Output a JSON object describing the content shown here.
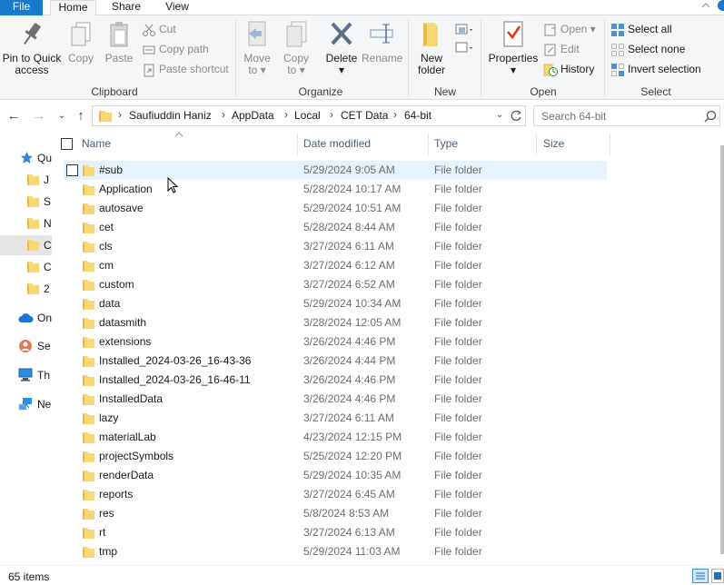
{
  "tabs": {
    "file": "File",
    "home": "Home",
    "share": "Share",
    "view": "View"
  },
  "ribbon": {
    "clipboard": {
      "pin_line1": "Pin to Quick",
      "pin_line2": "access",
      "copy": "Copy",
      "paste": "Paste",
      "cut": "Cut",
      "copy_path": "Copy path",
      "paste_shortcut": "Paste shortcut",
      "label": "Clipboard"
    },
    "organize": {
      "move_line1": "Move",
      "move_line2": "to",
      "copy_line1": "Copy",
      "copy_line2": "to",
      "delete": "Delete",
      "rename": "Rename",
      "label": "Organize"
    },
    "new": {
      "new_line1": "New",
      "new_line2": "folder",
      "label": "New"
    },
    "open": {
      "properties": "Properties",
      "open": "Open",
      "edit": "Edit",
      "history": "History",
      "label": "Open"
    },
    "select": {
      "select_all": "Select all",
      "select_none": "Select none",
      "invert": "Invert selection",
      "label": "Select"
    }
  },
  "address": {
    "crumbs": [
      "Saufiuddin Haniz",
      "AppData",
      "Local",
      "CET Data",
      "64-bit"
    ],
    "search_placeholder": "Search 64-bit"
  },
  "nav": {
    "items": [
      {
        "label": "Qu",
        "icon": "star-icon"
      },
      {
        "label": "J",
        "icon": "folder-icon"
      },
      {
        "label": "S",
        "icon": "folder-icon"
      },
      {
        "label": "N",
        "icon": "folder-icon"
      },
      {
        "label": "C",
        "icon": "folder-icon"
      },
      {
        "label": "C",
        "icon": "folder-icon"
      },
      {
        "label": "2",
        "icon": "folder-icon"
      },
      {
        "label": "On",
        "icon": "cloud-icon"
      },
      {
        "label": "Se",
        "icon": "user-icon"
      },
      {
        "label": "Th",
        "icon": "computer-icon"
      },
      {
        "label": "Ne",
        "icon": "network-icon"
      }
    ]
  },
  "columns": {
    "name": "Name",
    "date": "Date modified",
    "type": "Type",
    "size": "Size"
  },
  "files": [
    {
      "name": "#sub",
      "date": "5/29/2024 9:05 AM",
      "type": "File folder"
    },
    {
      "name": "Application",
      "date": "5/28/2024 10:17 AM",
      "type": "File folder"
    },
    {
      "name": "autosave",
      "date": "5/29/2024 10:51 AM",
      "type": "File folder"
    },
    {
      "name": "cet",
      "date": "5/28/2024 8:44 AM",
      "type": "File folder"
    },
    {
      "name": "cls",
      "date": "3/27/2024 6:11 AM",
      "type": "File folder"
    },
    {
      "name": "cm",
      "date": "3/27/2024 6:12 AM",
      "type": "File folder"
    },
    {
      "name": "custom",
      "date": "3/27/2024 6:52 AM",
      "type": "File folder"
    },
    {
      "name": "data",
      "date": "5/29/2024 10:34 AM",
      "type": "File folder"
    },
    {
      "name": "datasmith",
      "date": "3/28/2024 12:05 AM",
      "type": "File folder"
    },
    {
      "name": "extensions",
      "date": "3/26/2024 4:46 PM",
      "type": "File folder"
    },
    {
      "name": "Installed_2024-03-26_16-43-36",
      "date": "3/26/2024 4:44 PM",
      "type": "File folder"
    },
    {
      "name": "Installed_2024-03-26_16-46-11",
      "date": "3/26/2024 4:46 PM",
      "type": "File folder"
    },
    {
      "name": "InstalledData",
      "date": "3/26/2024 4:46 PM",
      "type": "File folder"
    },
    {
      "name": "lazy",
      "date": "3/27/2024 6:11 AM",
      "type": "File folder"
    },
    {
      "name": "materialLab",
      "date": "4/23/2024 12:15 PM",
      "type": "File folder"
    },
    {
      "name": "projectSymbols",
      "date": "5/25/2024 12:20 PM",
      "type": "File folder"
    },
    {
      "name": "renderData",
      "date": "5/29/2024 10:35 AM",
      "type": "File folder"
    },
    {
      "name": "reports",
      "date": "3/27/2024 6:45 AM",
      "type": "File folder"
    },
    {
      "name": "res",
      "date": "5/8/2024 8:53 AM",
      "type": "File folder"
    },
    {
      "name": "rt",
      "date": "3/27/2024 6:13 AM",
      "type": "File folder"
    },
    {
      "name": "tmp",
      "date": "5/29/2024 11:03 AM",
      "type": "File folder"
    }
  ],
  "status": {
    "count": "65 items"
  },
  "colors": {
    "accent": "#1979ca",
    "folder": "#f8d775",
    "folder_dark": "#e8b84a",
    "selection": "#e5f3ff"
  }
}
